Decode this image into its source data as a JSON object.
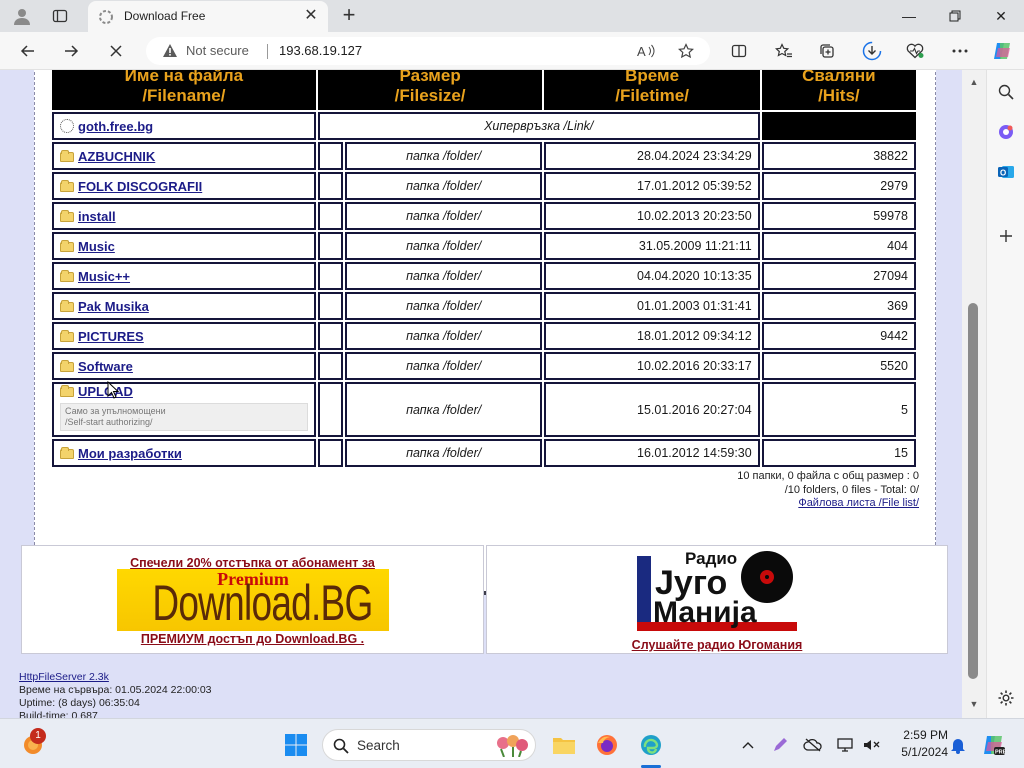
{
  "browser": {
    "tab_title": "Download Free",
    "not_secure_label": "Not secure",
    "url": "193.68.19.127",
    "window_buttons": [
      "minimize-icon",
      "restore-icon",
      "close-icon"
    ]
  },
  "table": {
    "headers": [
      {
        "bg": "Име на файла",
        "en": "/Filename/"
      },
      {
        "bg": "Размер",
        "en": "/Filesize/"
      },
      {
        "bg": "Време",
        "en": "/Filetime/"
      },
      {
        "bg": "Сваляни",
        "en": "/Hits/"
      }
    ],
    "link_row": {
      "name": "goth.free.bg",
      "label": "Хипервръзка /Link/"
    },
    "rows": [
      {
        "name": "AZBUCHNIK",
        "type": "папка /folder/",
        "time": "28.04.2024 23:34:29",
        "hits": "38822"
      },
      {
        "name": "FOLK DISCOGRAFII",
        "type": "папка /folder/",
        "time": "17.01.2012 05:39:52",
        "hits": "2979"
      },
      {
        "name": "install",
        "type": "папка /folder/",
        "time": "10.02.2013 20:23:50",
        "hits": "59978"
      },
      {
        "name": "Music",
        "type": "папка /folder/",
        "time": "31.05.2009 11:21:11",
        "hits": "404"
      },
      {
        "name": "Music++",
        "type": "папка /folder/",
        "time": "04.04.2020 10:13:35",
        "hits": "27094"
      },
      {
        "name": "Pak Musika",
        "type": "папка /folder/",
        "time": "01.01.2003 01:31:41",
        "hits": "369"
      },
      {
        "name": "PICTURES",
        "type": "папка /folder/",
        "time": "18.01.2012 09:34:12",
        "hits": "9442"
      },
      {
        "name": "Software",
        "type": "папка /folder/",
        "time": "10.02.2016 20:33:17",
        "hits": "5520"
      },
      {
        "name": "UPLOAD",
        "type": "папка /folder/",
        "time": "15.01.2016 20:27:04",
        "hits": "5",
        "note_bg": "Само за упълномощени",
        "note_en": "/Self-start authorizing/"
      },
      {
        "name": "Мои разработки",
        "type": "папка /folder/",
        "time": "16.01.2012 14:59:30",
        "hits": "15"
      }
    ],
    "summary_line1": "10 папки, 0 файла с общ размер : 0",
    "summary_line2": "/10 folders, 0 files - Total: 0/",
    "file_list_link": "Файлова листа /File list/"
  },
  "banners": {
    "left": {
      "top_text": "Спечели 20% отстъпка от абонамент за",
      "logo_premium": "Premium",
      "logo_text": "Download.BG",
      "bottom_text": "ПРЕМИУМ достъп до Download.BG ."
    },
    "right": {
      "logo_word1": "Радио",
      "logo_word2": "Југо",
      "logo_word3": "Манија",
      "bottom_text": "Слушайте радио Югомания"
    }
  },
  "footer": {
    "server_link": "HttpFileServer 2.3k",
    "server_time": "Време на сървъра: 01.05.2024 22:00:03",
    "uptime": "Uptime: (8 days) 06:35:04",
    "build_time": "Build-time: 0.687"
  },
  "taskbar": {
    "search_placeholder": "Search",
    "time": "2:59 PM",
    "date": "5/1/2024",
    "notification_count": "1"
  },
  "colors": {
    "header_bg": "#000000",
    "header_text": "#e9a21d",
    "link": "#1c1c88",
    "page_bg": "#dde0f7"
  }
}
